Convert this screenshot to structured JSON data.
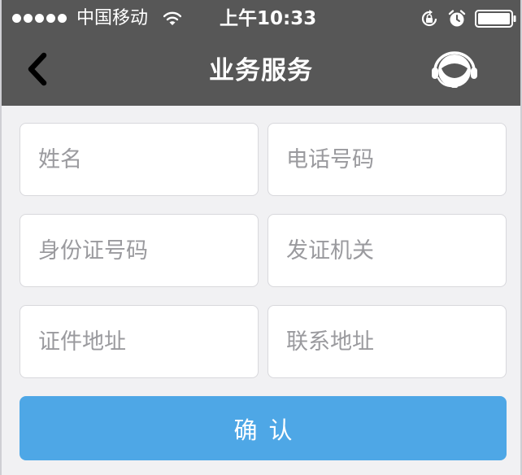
{
  "status_bar": {
    "carrier": "中国移动",
    "time": "上午10:33",
    "icons": [
      "signal-dots-icon",
      "wifi-icon",
      "rotation-lock-icon",
      "alarm-icon",
      "battery-icon"
    ]
  },
  "nav": {
    "title": "业务服务",
    "back_icon": "chevron-left-icon",
    "support_icon": "headset-support-icon"
  },
  "form": {
    "name": {
      "placeholder": "姓名",
      "value": ""
    },
    "phone": {
      "placeholder": "电话号码",
      "value": ""
    },
    "id_number": {
      "placeholder": "身份证号码",
      "value": ""
    },
    "issuing_authority": {
      "placeholder": "发证机关",
      "value": ""
    },
    "id_address": {
      "placeholder": "证件地址",
      "value": ""
    },
    "contact_address": {
      "placeholder": "联系地址",
      "value": ""
    },
    "confirm_label": "确认"
  },
  "colors": {
    "header_bg": "#575757",
    "page_bg": "#f1f1f3",
    "accent": "#4ea7e6",
    "field_border": "#d8d8dc",
    "placeholder": "#9a9a9e"
  }
}
